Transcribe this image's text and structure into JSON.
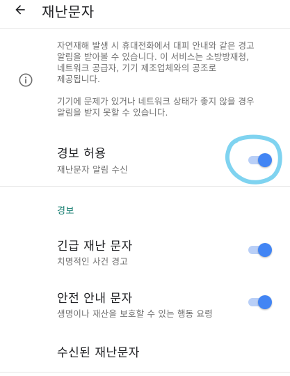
{
  "appbar": {
    "title": "재난문자",
    "back_icon": "arrow-left-icon"
  },
  "info": {
    "icon": "info-outline-icon",
    "paragraph1_lines": [
      "자연재해 발생 시 휴대전화에서 대피 안내와 같은 경고",
      "알림을 받아볼 수 있습니다. 이 서비스는 소방방재청,",
      "네트워크 공급자, 기기 제조업체와의 공조로",
      "제공됩니다."
    ],
    "paragraph2_lines": [
      "기기에 문제가 있거나 네트워크 상태가 좋지 않을 경우",
      "알림을 받지 못할 수 있습니다."
    ]
  },
  "allow_alerts": {
    "title": "경보 허용",
    "subtitle": "재난문자 알림 수신",
    "enabled": true
  },
  "alerts_section": {
    "header": "경보",
    "items": [
      {
        "title": "긴급 재난 문자",
        "subtitle": "치명적인 사건 경고",
        "enabled": true
      },
      {
        "title": "안전 안내 문자",
        "subtitle": "생명이나 재산을 보호할 수 있는 행동 요령",
        "enabled": true
      }
    ]
  },
  "received": {
    "title": "수신된 재난문자"
  },
  "colors": {
    "accent": "#4285f4",
    "switch_track": "#b9cff7",
    "section_header": "#0f7a6c",
    "annotation_circle": "#7fd3f0"
  }
}
